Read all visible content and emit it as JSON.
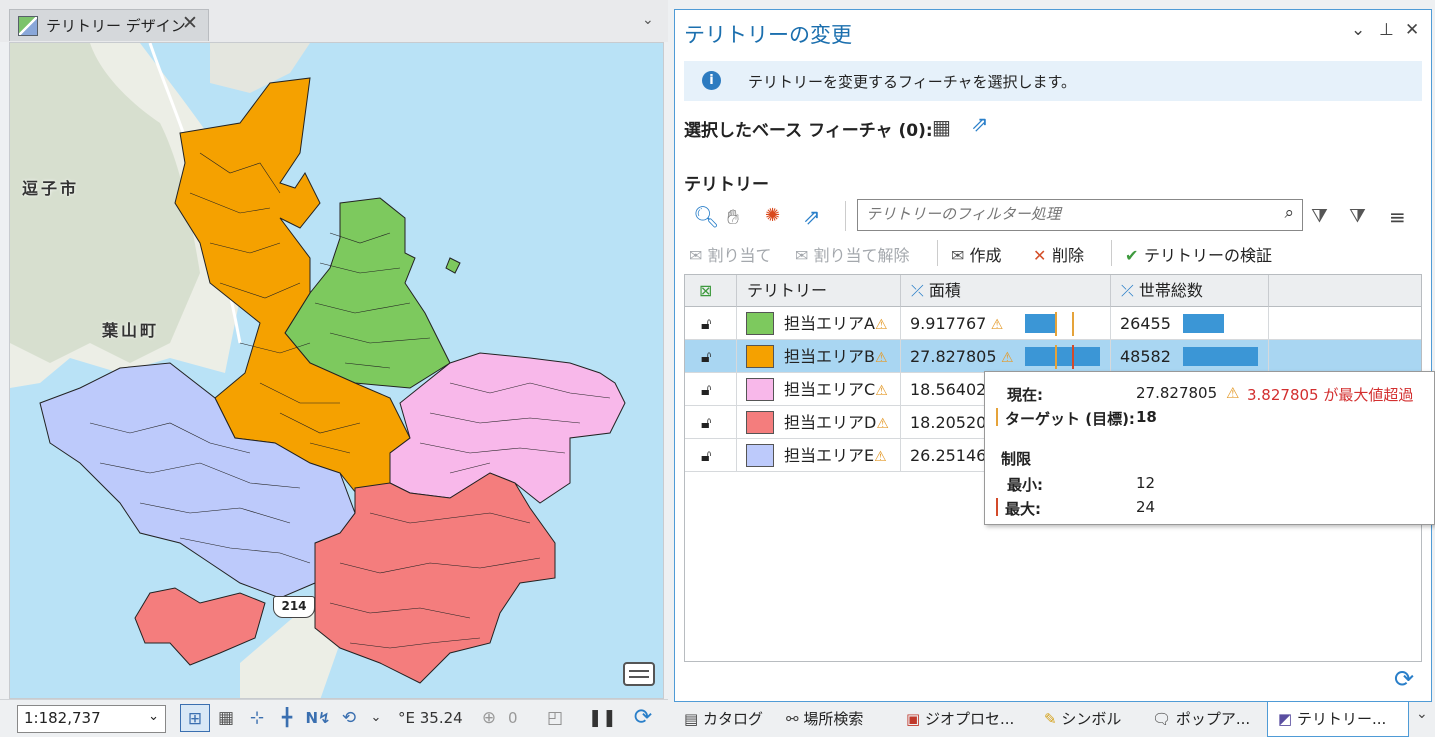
{
  "map_window": {
    "tab_title": "テリトリー デザイン",
    "close_symbol": "✕",
    "menu_symbol": "⌄",
    "labels": {
      "zushi": "逗子市",
      "hayama": "葉山町"
    },
    "road_number": "214"
  },
  "status_bar": {
    "scale": "1:182,737",
    "coordinates": "°E 35.24",
    "selected_count": "0"
  },
  "panel": {
    "title": "テリトリーの変更",
    "info_message": "テリトリーを変更するフィーチャを選択します。",
    "base_features_label": "選択したベース フィーチャ (0):",
    "territories_header": "テリトリー",
    "filter_placeholder": "テリトリーのフィルター処理",
    "actions": {
      "assign": "割り当て",
      "unassign": "割り当て解除",
      "create": "作成",
      "delete": "削除",
      "validate": "テリトリーの検証"
    },
    "grid": {
      "columns": [
        "テリトリー",
        "面積",
        "世帯総数"
      ],
      "rows": [
        {
          "name": "担当エリアA",
          "color": "#7dc95e",
          "area": "9.917767",
          "households": "26455",
          "area_fraction": 0.41,
          "households_fraction": 0.54,
          "selected": false
        },
        {
          "name": "担当エリアB",
          "color": "#f5a100",
          "area": "27.827805",
          "households": "48582",
          "area_fraction": 1.0,
          "households_fraction": 1.0,
          "selected": true
        },
        {
          "name": "担当エリアC",
          "color": "#f8b8ea",
          "area": "18.56402",
          "households": "",
          "selected": false
        },
        {
          "name": "担当エリアD",
          "color": "#f47d7d",
          "area": "18.20520",
          "households": "",
          "selected": false
        },
        {
          "name": "担当エリアE",
          "color": "#bdcafb",
          "area": "26.25146",
          "households": "",
          "selected": false
        }
      ]
    }
  },
  "tooltip": {
    "current_label": "現在:",
    "current_value": "27.827805",
    "exceed_message": "3.827805 が最大値超過",
    "target_label": "ターゲット (目標):",
    "target_value": "18",
    "limits_header": "制限",
    "min_label": "最小:",
    "min_value": "12",
    "max_label": "最大:",
    "max_value": "24"
  },
  "bottom_tabs": [
    "カタログ",
    "場所検索",
    "ジオプロセ...",
    "シンボル",
    "ポップア...",
    "テリトリー..."
  ],
  "colors": {
    "accent": "#1b6fae",
    "area_a": "#7dc95e",
    "area_b": "#f5a100",
    "area_c": "#f8b8ea",
    "area_d": "#f47d7d",
    "area_e": "#bdcafb",
    "warning": "#e49b2b",
    "error": "#d32f2f"
  }
}
